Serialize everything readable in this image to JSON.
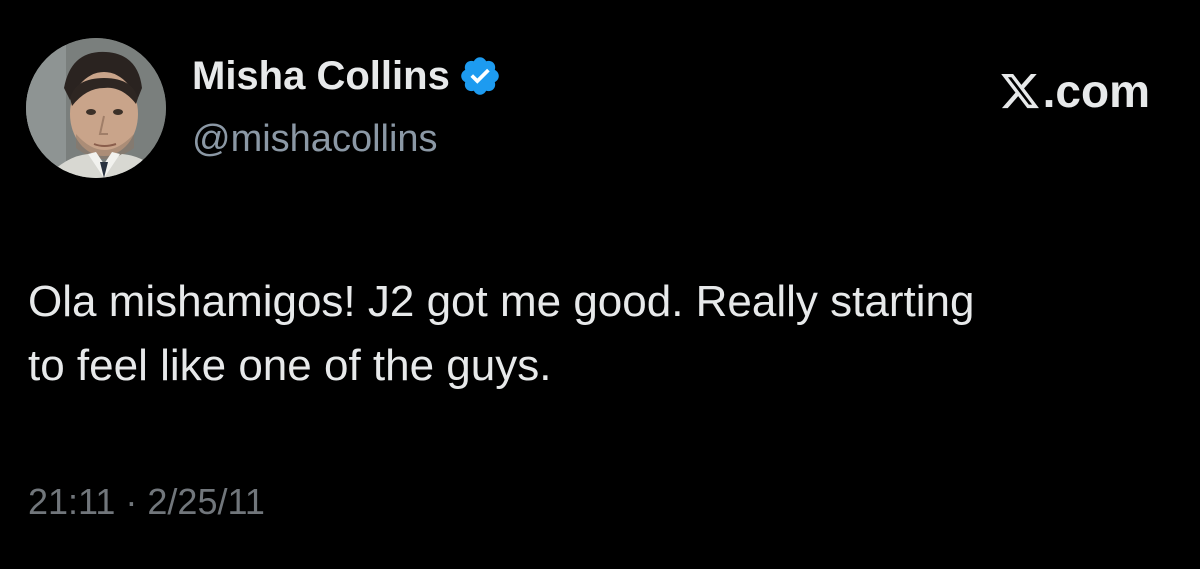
{
  "tweet": {
    "author_name": "Misha Collins",
    "author_handle": "@mishacollins",
    "verified": true,
    "brand": ".com",
    "brand_icon": "x-logo-icon",
    "text": "Ola mishamigos! J2 got me good. Really starting\nto feel like one of the guys.",
    "time": "21:11 · 2/25/11"
  },
  "colors": {
    "background": "#000000",
    "primary_text": "#e7e9ea",
    "secondary_text": "#8b98a5",
    "verified_blue": "#1d9bf0"
  }
}
